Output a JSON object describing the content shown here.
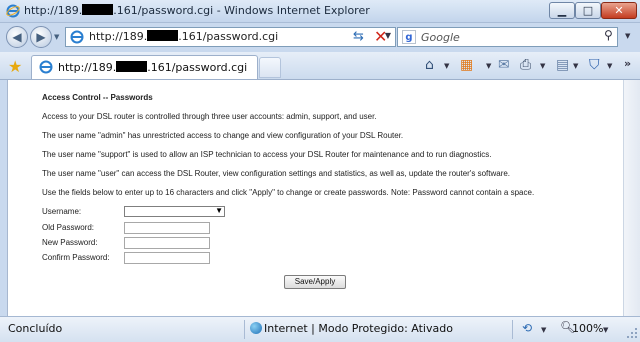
{
  "window": {
    "title_pre": "http://189.",
    "title_post": ".161/password.cgi - Windows Internet Explorer"
  },
  "address": {
    "url_pre": "http://189.",
    "url_post": ".161/password.cgi"
  },
  "search": {
    "placeholder": "Google"
  },
  "tab": {
    "label_pre": "http://189.",
    "label_post": ".161/password.cgi"
  },
  "page": {
    "heading": "Access Control -- Passwords",
    "paragraphs": [
      "Access to your DSL router is controlled through three user accounts: admin, support, and user.",
      "The user name \"admin\" has unrestricted access to change and view configuration of your DSL Router.",
      "The user name \"support\" is used to allow an ISP technician to access your DSL Router for maintenance and to run diagnostics.",
      "The user name \"user\" can access the DSL Router, view configuration settings and statistics, as well as, update the router's software.",
      "Use the fields below to enter up to 16 characters and click \"Apply\" to change or create passwords. Note: Password cannot contain a space."
    ],
    "labels": {
      "username": "Username:",
      "old_password": "Old Password:",
      "new_password": "New Password:",
      "confirm_password": "Confirm Password:"
    },
    "username_value": "",
    "button": "Save/Apply"
  },
  "status": {
    "left": "Concluído",
    "zone": "Internet | Modo Protegido: Ativado",
    "zoom": "100%"
  }
}
